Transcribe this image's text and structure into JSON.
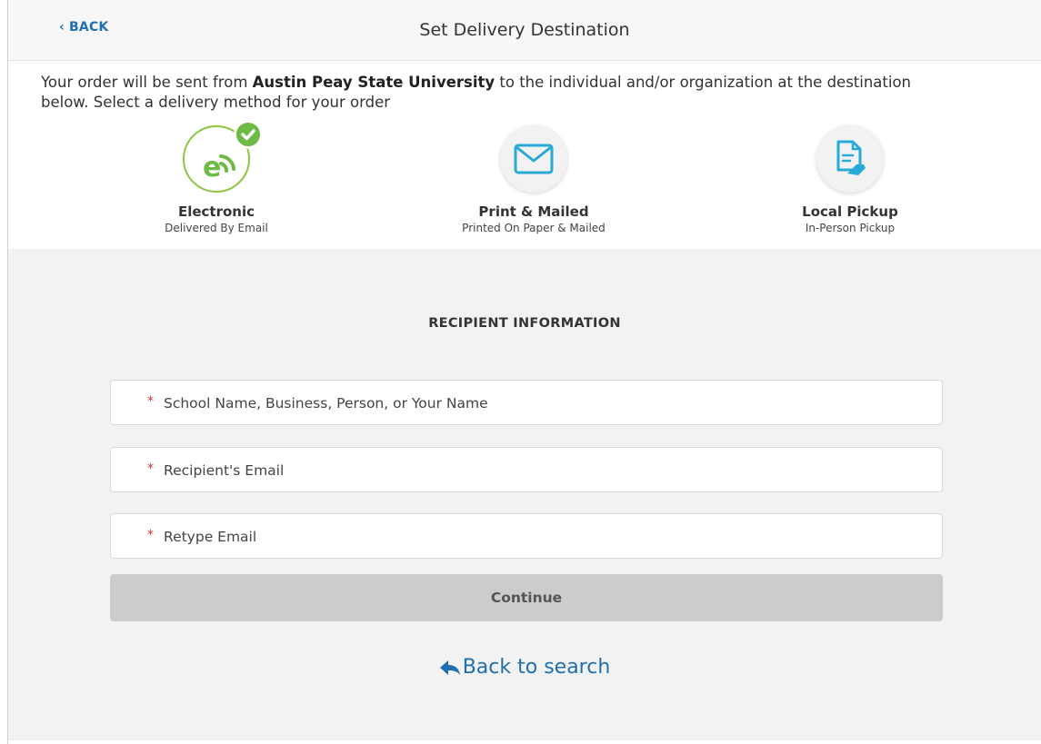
{
  "header": {
    "back_label": "‹ BACK",
    "title": "Set Delivery Destination"
  },
  "intro": {
    "prefix": "Your order will be sent from ",
    "institution": "Austin Peay State University",
    "suffix": " to the individual and/or organization at the destination below. Select a delivery method for your order"
  },
  "methods": [
    {
      "title": "Electronic",
      "subtitle": "Delivered By Email",
      "icon": "electronic-delivery-icon",
      "selected": true
    },
    {
      "title": "Print & Mailed",
      "subtitle": "Printed On Paper & Mailed",
      "icon": "envelope-icon",
      "selected": false
    },
    {
      "title": "Local Pickup",
      "subtitle": "In-Person Pickup",
      "icon": "document-hand-icon",
      "selected": false
    }
  ],
  "recipient": {
    "section_title": "RECIPIENT INFORMATION",
    "required_marker": "*",
    "fields": [
      {
        "placeholder": "School Name, Business, Person, or Your Name",
        "value": ""
      },
      {
        "placeholder": "Recipient's Email",
        "value": ""
      },
      {
        "placeholder": "Retype Email",
        "value": ""
      }
    ],
    "continue_label": "Continue",
    "back_to_search_label": "Back to search"
  },
  "colors": {
    "accent_blue": "#1f6fb0",
    "selected_green": "#6dba44",
    "icon_teal": "#29a9d6",
    "required_red": "#c0392b",
    "button_disabled": "#cccccc"
  }
}
